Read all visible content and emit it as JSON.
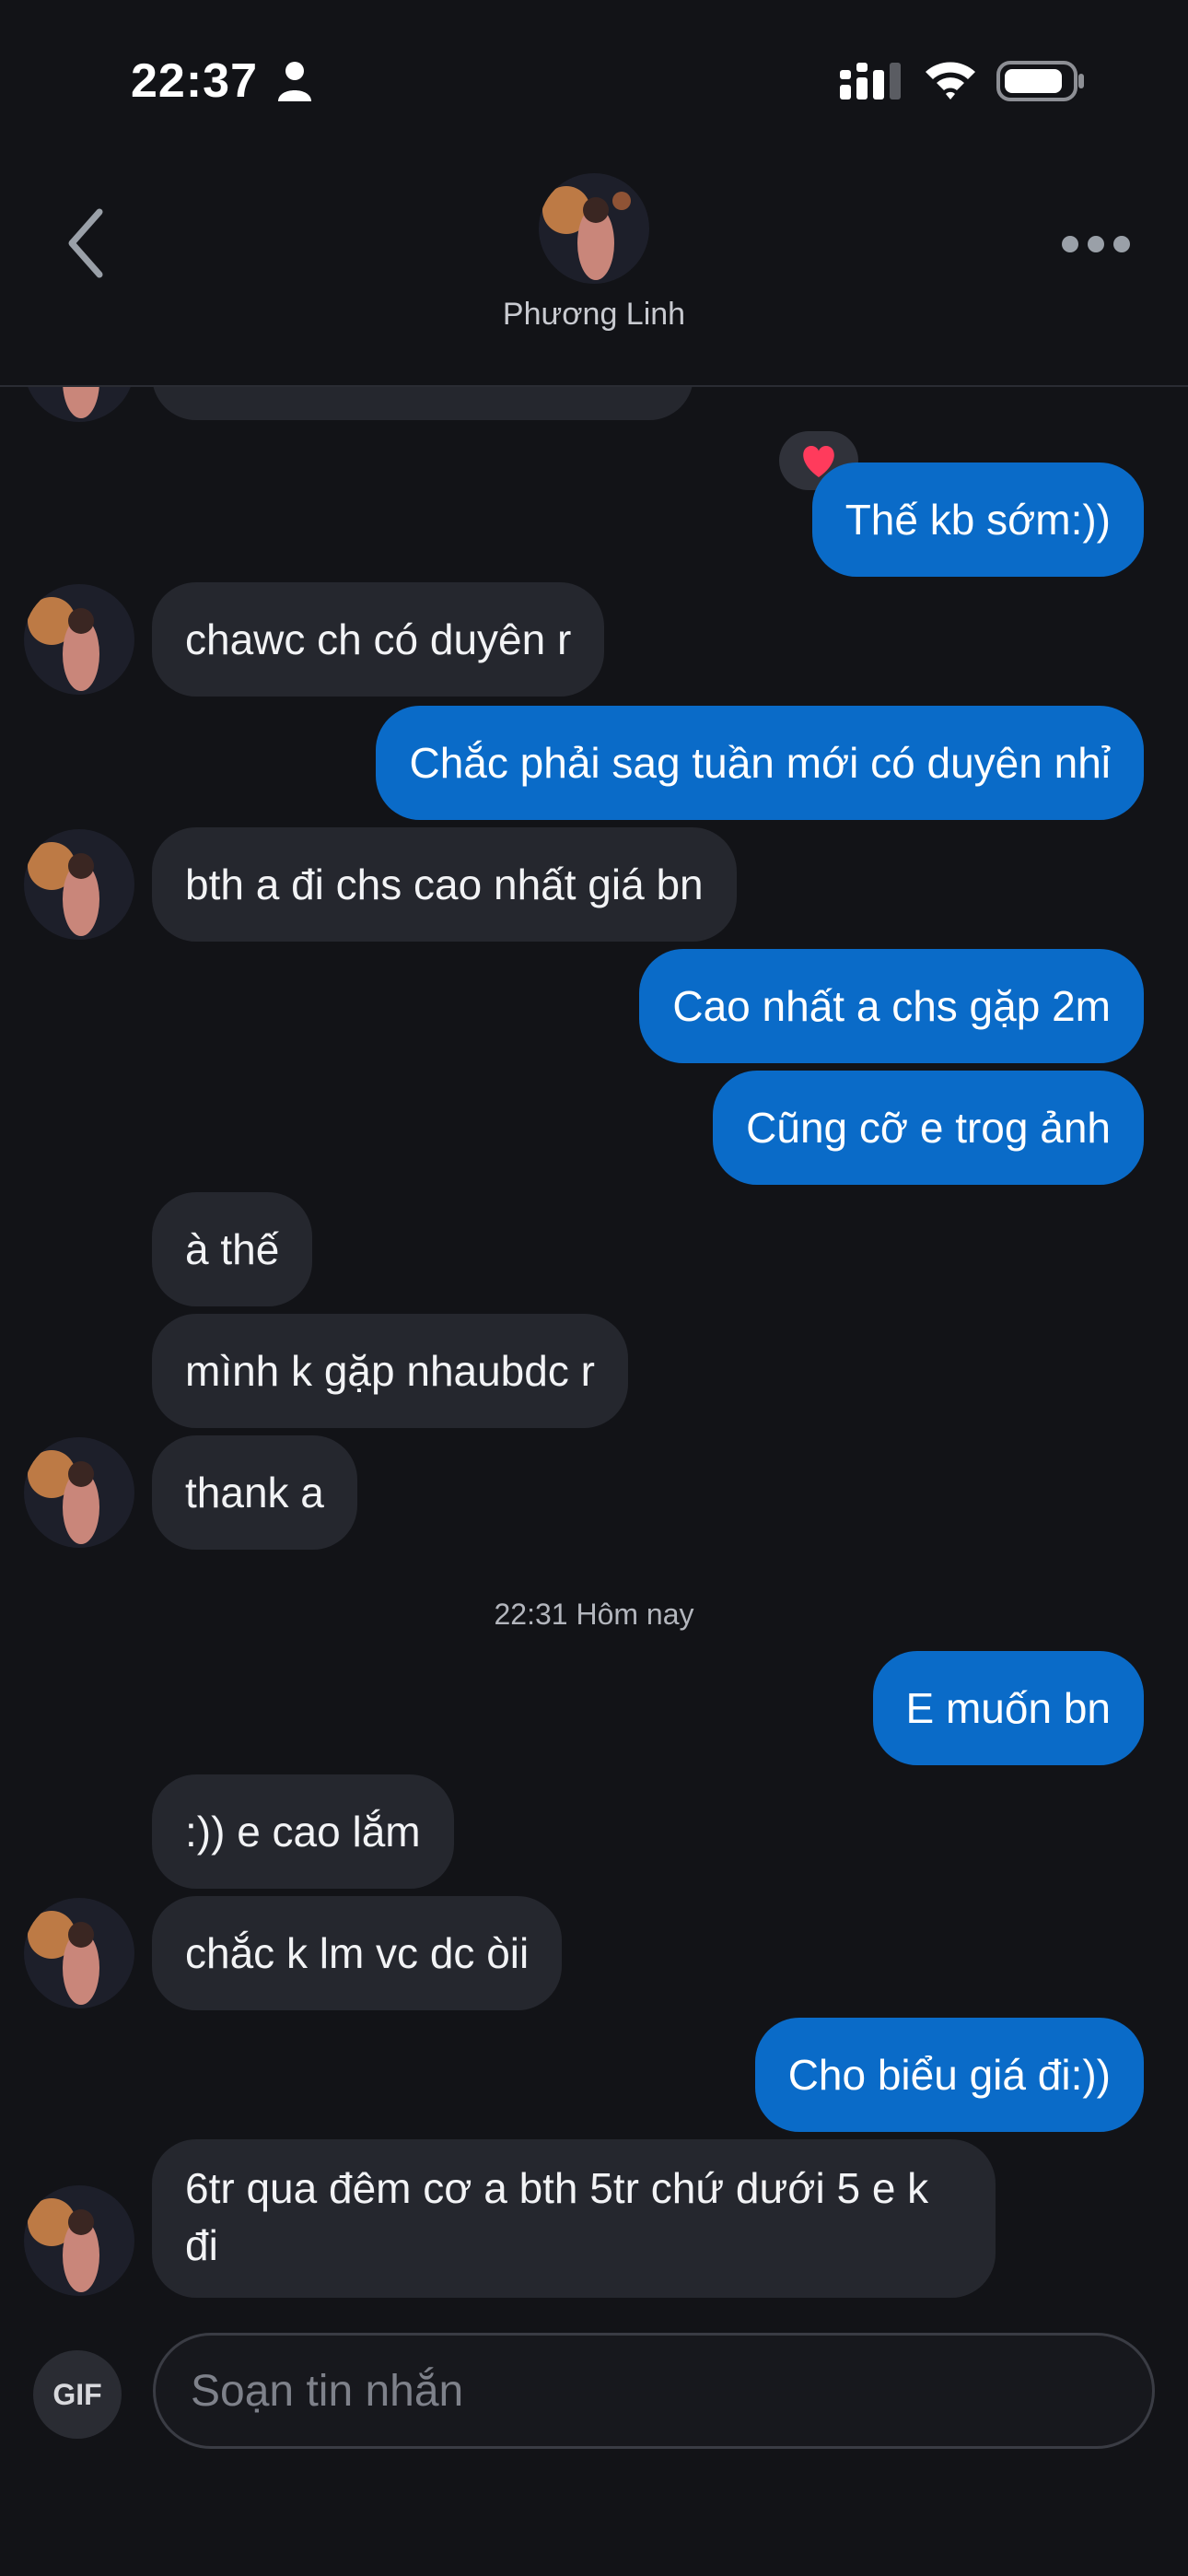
{
  "status_bar": {
    "time": "22:37"
  },
  "header": {
    "contact_name": "Phương Linh"
  },
  "messages": [
    {
      "side": "out",
      "text": "Thế kb sớm:))"
    },
    {
      "side": "in",
      "text": "chawc ch có duyên r"
    },
    {
      "side": "out",
      "text": "Chắc phải sag tuần mới có duyên nhỉ"
    },
    {
      "side": "in",
      "text": "bth a đi chs cao nhất giá bn"
    },
    {
      "side": "out",
      "text": "Cao nhất a chs gặp 2m"
    },
    {
      "side": "out",
      "text": "Cũng cỡ e trog ảnh"
    },
    {
      "side": "in",
      "text": "à thế"
    },
    {
      "side": "in",
      "text": "mình k gặp nhaubdc r"
    },
    {
      "side": "in",
      "text": "thank a"
    },
    {
      "side": "out",
      "text": "E muốn bn"
    },
    {
      "side": "in",
      "text": ":)) e cao lắm"
    },
    {
      "side": "in",
      "text": "chắc k lm vc dc òii"
    },
    {
      "side": "out",
      "text": "Cho biểu giá đi:))"
    },
    {
      "side": "in",
      "text": "6tr qua đêm cơ a bth 5tr chứ dưới 5 e k đi"
    }
  ],
  "timestamp": "22:31 Hôm nay",
  "reaction": {
    "icon": "heart-icon",
    "color": "#ff3b5c"
  },
  "composer": {
    "gif_label": "GIF",
    "placeholder": "Soạn tin nhắn"
  },
  "colors": {
    "outgoing": "#0a6bc8",
    "incoming": "#25272e",
    "background": "#121317"
  }
}
